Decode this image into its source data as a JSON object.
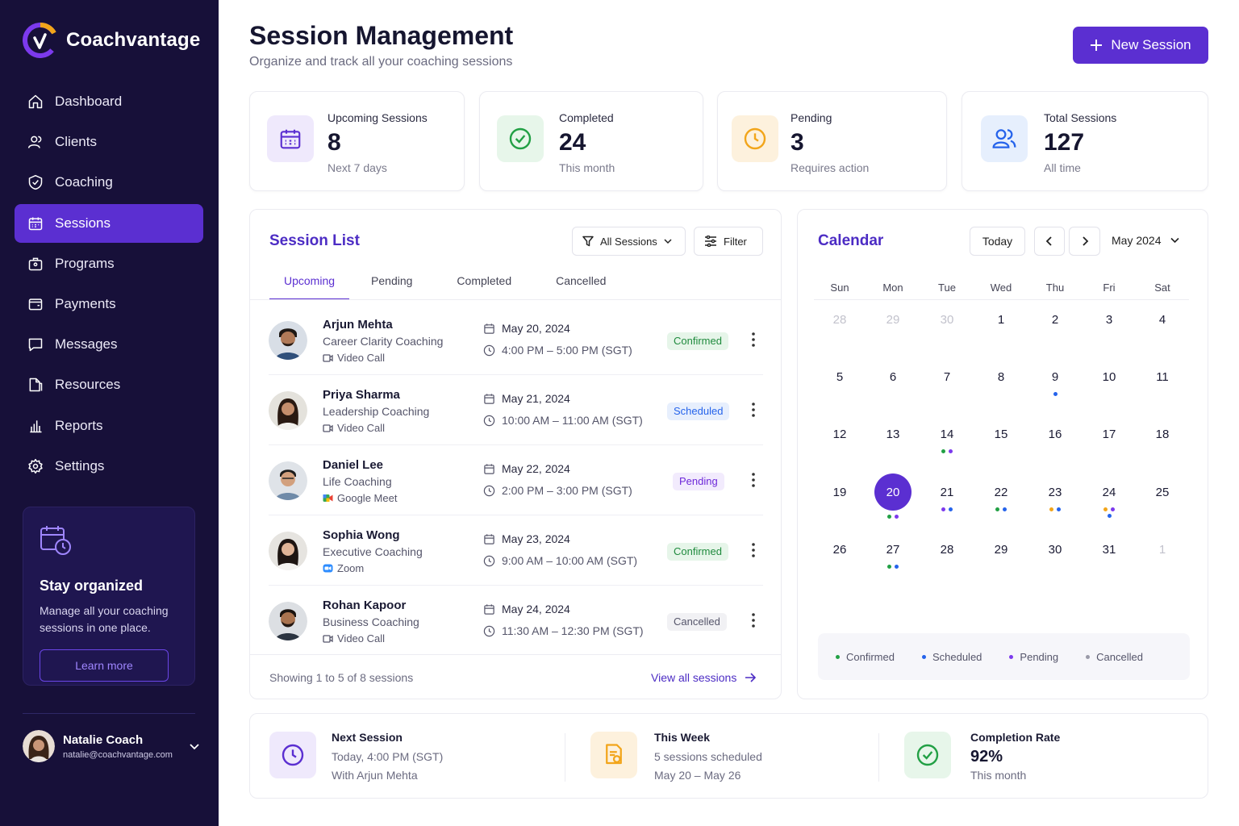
{
  "colors": {
    "sidebar": "#171039",
    "accent": "#5b2fd1",
    "confirmed": "#22a045",
    "scheduled": "#2563eb",
    "pending": "#7c3aed",
    "cancelled": "#9a9aa8",
    "orange": "#f2a51a"
  },
  "brand": {
    "name": "Coachvantage"
  },
  "nav": [
    {
      "label": "Dashboard",
      "icon": "home-icon"
    },
    {
      "label": "Clients",
      "icon": "users-icon"
    },
    {
      "label": "Coaching",
      "icon": "shield-icon"
    },
    {
      "label": "Sessions",
      "icon": "calendar-icon",
      "active": true
    },
    {
      "label": "Programs",
      "icon": "briefcase-icon"
    },
    {
      "label": "Payments",
      "icon": "wallet-icon"
    },
    {
      "label": "Messages",
      "icon": "message-icon"
    },
    {
      "label": "Resources",
      "icon": "folder-icon"
    },
    {
      "label": "Reports",
      "icon": "bar-chart-icon"
    },
    {
      "label": "Settings",
      "icon": "gear-icon"
    }
  ],
  "promo": {
    "title": "Stay organized",
    "text": "Manage all your coaching sessions in one place.",
    "button": "Learn more"
  },
  "user": {
    "name": "Natalie Coach",
    "email": "natalie@coachvantage.com"
  },
  "header": {
    "title": "Session Management",
    "subtitle": "Organize and track all your coaching sessions",
    "new_button": "New Session"
  },
  "stats": [
    {
      "label": "Upcoming Sessions",
      "value": "8",
      "sub": "Next 7 days",
      "icon": "calendar-icon"
    },
    {
      "label": "Completed",
      "value": "24",
      "sub": "This month",
      "icon": "check-circle-icon"
    },
    {
      "label": "Pending",
      "value": "3",
      "sub": "Requires action",
      "icon": "clock-icon"
    },
    {
      "label": "Total Sessions",
      "value": "127",
      "sub": "All time",
      "icon": "users-icon"
    }
  ],
  "session_list": {
    "title": "Session List",
    "dropdown": "All Sessions",
    "filter": "Filter",
    "tabs": [
      "Upcoming",
      "Pending",
      "Completed",
      "Cancelled"
    ],
    "active_tab": "Upcoming",
    "rows": [
      {
        "name": "Arjun Mehta",
        "program": "Career Clarity Coaching",
        "mode": "Video Call",
        "date": "May 20, 2024",
        "time": "4:00 PM – 5:00 PM (SGT)",
        "status": "Confirmed"
      },
      {
        "name": "Priya Sharma",
        "program": "Leadership Coaching",
        "mode": "Video Call",
        "date": "May 21, 2024",
        "time": "10:00 AM – 11:00 AM (SGT)",
        "status": "Scheduled"
      },
      {
        "name": "Daniel Lee",
        "program": "Life Coaching",
        "mode": "Google Meet",
        "date": "May 22, 2024",
        "time": "2:00 PM – 3:00 PM (SGT)",
        "status": "Pending"
      },
      {
        "name": "Sophia Wong",
        "program": "Executive Coaching",
        "mode": "Zoom",
        "date": "May 23, 2024",
        "time": "9:00 AM – 10:00 AM (SGT)",
        "status": "Confirmed"
      },
      {
        "name": "Rohan Kapoor",
        "program": "Business Coaching",
        "mode": "Video Call",
        "date": "May 24, 2024",
        "time": "11:30 AM – 12:30 PM (SGT)",
        "status": "Cancelled"
      }
    ],
    "footer": "Showing 1 to 5 of 8 sessions",
    "view_all": "View all sessions"
  },
  "calendar": {
    "title": "Calendar",
    "today_button": "Today",
    "month": "May 2024",
    "weekdays": [
      "Sun",
      "Mon",
      "Tue",
      "Wed",
      "Thu",
      "Fri",
      "Sat"
    ],
    "weeks": [
      [
        {
          "d": "28",
          "m": true
        },
        {
          "d": "29",
          "m": true
        },
        {
          "d": "30",
          "m": true
        },
        {
          "d": "1"
        },
        {
          "d": "2"
        },
        {
          "d": "3"
        },
        {
          "d": "4"
        }
      ],
      [
        {
          "d": "5"
        },
        {
          "d": "6"
        },
        {
          "d": "7"
        },
        {
          "d": "8"
        },
        {
          "d": "9",
          "dots": [
            "scheduled"
          ]
        },
        {
          "d": "10"
        },
        {
          "d": "11"
        }
      ],
      [
        {
          "d": "12"
        },
        {
          "d": "13"
        },
        {
          "d": "14",
          "dots": [
            "confirmed",
            "pending"
          ]
        },
        {
          "d": "15"
        },
        {
          "d": "16"
        },
        {
          "d": "17"
        },
        {
          "d": "18"
        }
      ],
      [
        {
          "d": "19"
        },
        {
          "d": "20",
          "selected": true,
          "dots": [
            "confirmed",
            "pending"
          ]
        },
        {
          "d": "21",
          "dots": [
            "pending",
            "scheduled"
          ]
        },
        {
          "d": "22",
          "dots": [
            "confirmed",
            "scheduled"
          ]
        },
        {
          "d": "23",
          "dots": [
            "orange",
            "scheduled"
          ]
        },
        {
          "d": "24",
          "dots": [
            "orange",
            "pending",
            "scheduled"
          ]
        },
        {
          "d": "25"
        }
      ],
      [
        {
          "d": "26"
        },
        {
          "d": "27",
          "dots": [
            "confirmed",
            "scheduled"
          ]
        },
        {
          "d": "28"
        },
        {
          "d": "29"
        },
        {
          "d": "30"
        },
        {
          "d": "31"
        },
        {
          "d": "1",
          "m": true
        }
      ]
    ],
    "legend": [
      {
        "label": "Confirmed",
        "color": "#22a045"
      },
      {
        "label": "Scheduled",
        "color": "#2563eb"
      },
      {
        "label": "Pending",
        "color": "#7c3aed"
      },
      {
        "label": "Cancelled",
        "color": "#9a9aa8"
      }
    ]
  },
  "summary": {
    "next": {
      "title": "Next Session",
      "line1": "Today, 4:00 PM (SGT)",
      "line2": "With Arjun Mehta"
    },
    "week": {
      "title": "This Week",
      "line1": "5 sessions scheduled",
      "line2": "May 20 – May 26"
    },
    "rate": {
      "title": "Completion Rate",
      "value": "92%",
      "line2": "This month"
    }
  }
}
